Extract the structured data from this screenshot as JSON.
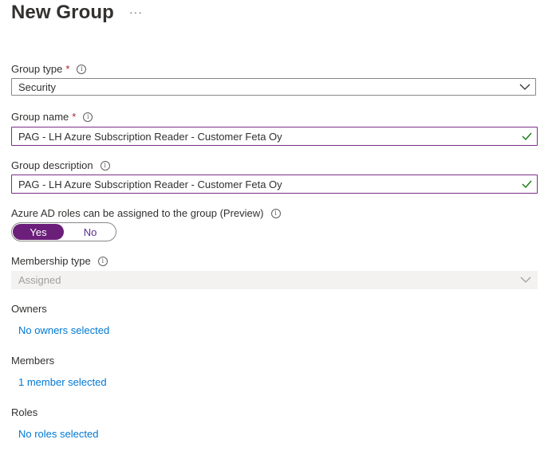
{
  "page": {
    "title": "New Group",
    "more_label": "···"
  },
  "group_type": {
    "label": "Group type",
    "required_mark": "*",
    "value": "Security"
  },
  "group_name": {
    "label": "Group name",
    "required_mark": "*",
    "value": "PAG - LH Azure Subscription Reader - Customer Feta Oy"
  },
  "group_description": {
    "label": "Group description",
    "value": "PAG - LH Azure Subscription Reader - Customer Feta Oy"
  },
  "azure_ad_roles": {
    "label": "Azure AD roles can be assigned to the group (Preview)",
    "yes_label": "Yes",
    "no_label": "No",
    "selected": "Yes"
  },
  "membership_type": {
    "label": "Membership type",
    "value": "Assigned"
  },
  "owners": {
    "label": "Owners",
    "link": "No owners selected"
  },
  "members": {
    "label": "Members",
    "link": "1 member selected"
  },
  "roles": {
    "label": "Roles",
    "link": "No roles selected"
  },
  "icons": {
    "info": "info-icon",
    "chevron": "chevron-down-icon",
    "check": "checkmark-icon"
  },
  "colors": {
    "accent": "#6b1f7a",
    "link": "#0078d4",
    "required": "#a4262c",
    "success": "#107c10"
  }
}
